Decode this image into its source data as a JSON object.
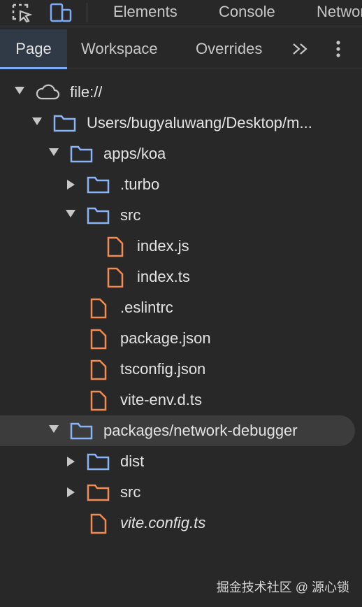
{
  "toolbar": {
    "tabs": [
      "Elements",
      "Console",
      "Network"
    ]
  },
  "subtabs": {
    "page": "Page",
    "workspace": "Workspace",
    "overrides": "Overrides",
    "more": "»"
  },
  "colors": {
    "folder_blue": "#8ab4f8",
    "folder_orange": "#f28b54",
    "file_orange": "#f28b54",
    "accent": "#7cacf8"
  },
  "tree": [
    {
      "label": "file://",
      "icon": "cloud-icon",
      "expanded": true,
      "depth": 0
    },
    {
      "label": "Users/bugyaluwang/Desktop/m...",
      "icon": "folder-icon",
      "expanded": true,
      "depth": 1
    },
    {
      "label": "apps/koa",
      "icon": "folder-icon",
      "expanded": true,
      "depth": 2
    },
    {
      "label": ".turbo",
      "icon": "folder-icon",
      "expanded": false,
      "depth": 3
    },
    {
      "label": "src",
      "icon": "folder-icon",
      "expanded": true,
      "depth": 3
    },
    {
      "label": "index.js",
      "icon": "file-icon",
      "depth": 4
    },
    {
      "label": "index.ts",
      "icon": "file-icon",
      "depth": 4
    },
    {
      "label": ".eslintrc",
      "icon": "file-icon",
      "depth": 3
    },
    {
      "label": "package.json",
      "icon": "file-icon",
      "depth": 3
    },
    {
      "label": "tsconfig.json",
      "icon": "file-icon",
      "depth": 3
    },
    {
      "label": "vite-env.d.ts",
      "icon": "file-icon",
      "depth": 3
    },
    {
      "label": "packages/network-debugger",
      "icon": "folder-icon",
      "expanded": true,
      "depth": 2,
      "selected": true
    },
    {
      "label": "dist",
      "icon": "folder-icon",
      "expanded": false,
      "depth": 3
    },
    {
      "label": "src",
      "icon": "folder-icon",
      "expanded": false,
      "depth": 3,
      "color": "orange"
    },
    {
      "label": "vite.config.ts",
      "icon": "file-icon",
      "depth": 3,
      "italic": true
    }
  ],
  "watermark": "掘金技术社区 @ 源心锁"
}
